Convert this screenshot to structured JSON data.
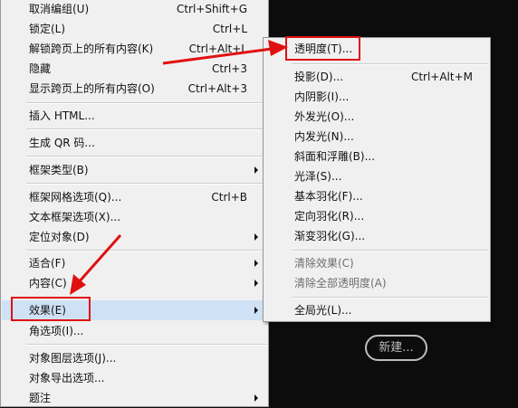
{
  "main_menu": {
    "items": [
      {
        "label": "取消编组(U)",
        "shortcut": "Ctrl+Shift+G"
      },
      {
        "label": "锁定(L)",
        "shortcut": "Ctrl+L"
      },
      {
        "label": "解锁跨页上的所有内容(K)",
        "shortcut": "Ctrl+Alt+L"
      },
      {
        "label": "隐藏",
        "shortcut": "Ctrl+3"
      },
      {
        "label": "显示跨页上的所有内容(O)",
        "shortcut": "Ctrl+Alt+3"
      },
      {
        "label": "插入 HTML..."
      },
      {
        "label": "生成 QR 码..."
      },
      {
        "label": "框架类型(B)"
      },
      {
        "label": "框架网格选项(Q)...",
        "shortcut": "Ctrl+B"
      },
      {
        "label": "文本框架选项(X)..."
      },
      {
        "label": "定位对象(D)"
      },
      {
        "label": "适合(F)"
      },
      {
        "label": "内容(C)"
      },
      {
        "label": "效果(E)"
      },
      {
        "label": "角选项(I)..."
      },
      {
        "label": "对象图层选项(J)..."
      },
      {
        "label": "对象导出选项..."
      },
      {
        "label": "题注"
      }
    ]
  },
  "sub_menu": {
    "items": [
      {
        "label": "透明度(T)..."
      },
      {
        "label": "投影(D)...",
        "shortcut": "Ctrl+Alt+M"
      },
      {
        "label": "内阴影(I)..."
      },
      {
        "label": "外发光(O)..."
      },
      {
        "label": "内发光(N)..."
      },
      {
        "label": "斜面和浮雕(B)..."
      },
      {
        "label": "光泽(S)..."
      },
      {
        "label": "基本羽化(F)..."
      },
      {
        "label": "定向羽化(R)..."
      },
      {
        "label": "渐变羽化(G)..."
      },
      {
        "label": "清除效果(C)"
      },
      {
        "label": "清除全部透明度(A)"
      },
      {
        "label": "全局光(L)..."
      }
    ]
  },
  "new_button": {
    "label": "新建..."
  },
  "colors": {
    "highlight": "#cfe1f4",
    "annotation_red": "#e01010",
    "background": "#0c0c0c"
  },
  "icons": {
    "submenu": "chevron-right-icon",
    "annotation": "red-arrow"
  }
}
